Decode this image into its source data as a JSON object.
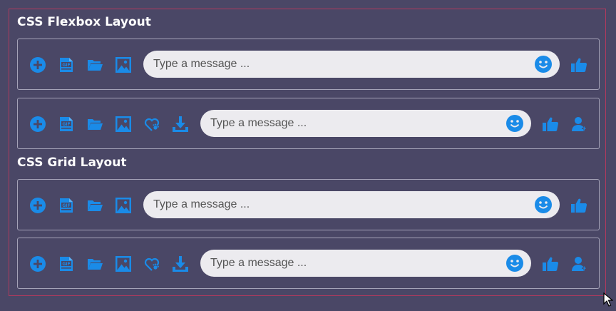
{
  "colors": {
    "background": "#4a4766",
    "accent": "#1a8be8",
    "input_bg": "#ecebef",
    "frame": "#b03a5e"
  },
  "sections": {
    "flexbox_title": "CSS Flexbox Layout",
    "grid_title": "CSS Grid Layout"
  },
  "composer": {
    "placeholder": "Type a message ..."
  },
  "icons": {
    "add": "plus-circle-icon",
    "gif": "gif-icon",
    "folder": "folder-icon",
    "image": "image-icon",
    "sticker": "paw-heart-icon",
    "download": "download-icon",
    "emoji": "smiley-icon",
    "like": "thumbs-up-icon",
    "contact": "user-plus-icon"
  }
}
